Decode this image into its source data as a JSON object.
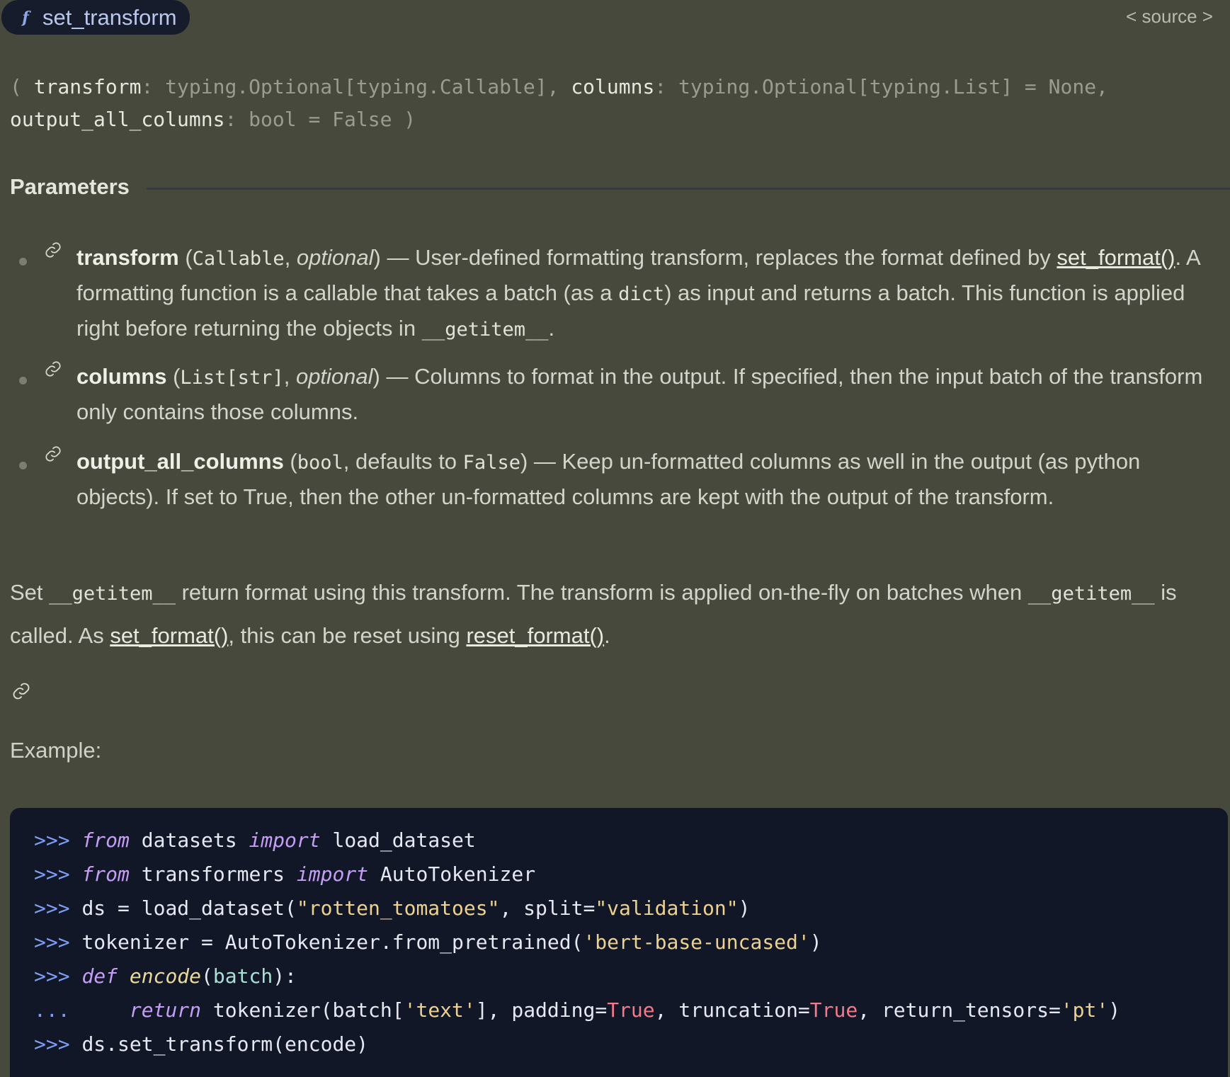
{
  "header": {
    "function_name": "set_transform",
    "source_link": "< source >"
  },
  "signature": {
    "open": "( ",
    "p1_name": "transform",
    "p1_rest": ": typing.Optional[typing.Callable], ",
    "p2_name": "columns",
    "p2_rest": ": typing.Optional[typing.List] = None,",
    "p3_name": "output_all_columns",
    "p3_rest": ": bool = False )"
  },
  "parameters": {
    "heading": "Parameters",
    "items": [
      {
        "name": "transform",
        "t1": " (",
        "type": "Callable",
        "t2": ", ",
        "opt": "optional",
        "t3": ") — User-defined formatting transform, replaces the format defined by ",
        "link": "set_format()",
        "t4": ". A formatting function is a callable that takes a batch (as a ",
        "code1": "dict",
        "t5": ") as input and returns a batch. This function is applied right before returning the objects in ",
        "code2": "__getitem__",
        "t6": "."
      },
      {
        "name": "columns",
        "t1": " (",
        "type": "List[str]",
        "t2": ", ",
        "opt": "optional",
        "t3": ") — Columns to format in the output. If specified, then the input batch of the transform only contains those columns."
      },
      {
        "name": "output_all_columns",
        "t1": " (",
        "type": "bool",
        "t2": ", defaults to ",
        "default": "False",
        "t3": ") — Keep un-formatted columns as well in the output (as python objects). If set to True, then the other un-formatted columns are kept with the output of the transform."
      }
    ]
  },
  "description": {
    "t1": "Set ",
    "code1": "__getitem__",
    "t2": " return format using this transform. The transform is applied on-the-fly on batches when ",
    "code2": "__getitem__",
    "t3": " is called. As ",
    "link1": "set_format()",
    "t4": ", this can be reset using ",
    "link2": "reset_format()",
    "t5": "."
  },
  "example_label": "Example:",
  "code": {
    "prompt": ">>>",
    "cont": "...",
    "l1_kw1": "from",
    "l1_mod": " datasets ",
    "l1_kw2": "import",
    "l1_name": " load_dataset",
    "l2_kw1": "from",
    "l2_mod": " transformers ",
    "l2_kw2": "import",
    "l2_name": " AutoTokenizer",
    "l3_a": "ds = load_dataset(",
    "l3_s1": "\"rotten_tomatoes\"",
    "l3_b": ", split=",
    "l3_s2": "\"validation\"",
    "l3_c": ")",
    "l4_a": "tokenizer = AutoTokenizer.from_pretrained(",
    "l4_s": "'bert-base-uncased'",
    "l4_b": ")",
    "l5_kw": "def",
    "l5_fn": "encode",
    "l5_a": "(",
    "l5_arg": "batch",
    "l5_b": "):",
    "l6_kw": "return",
    "l6_a": " tokenizer(batch[",
    "l6_s1": "'text'",
    "l6_b": "], padding=",
    "l6_t1": "True",
    "l6_c": ", truncation=",
    "l6_t2": "True",
    "l6_d": ", return_tensors=",
    "l6_s2": "'pt'",
    "l6_e": ")",
    "l7": "ds.set_transform(encode)"
  }
}
